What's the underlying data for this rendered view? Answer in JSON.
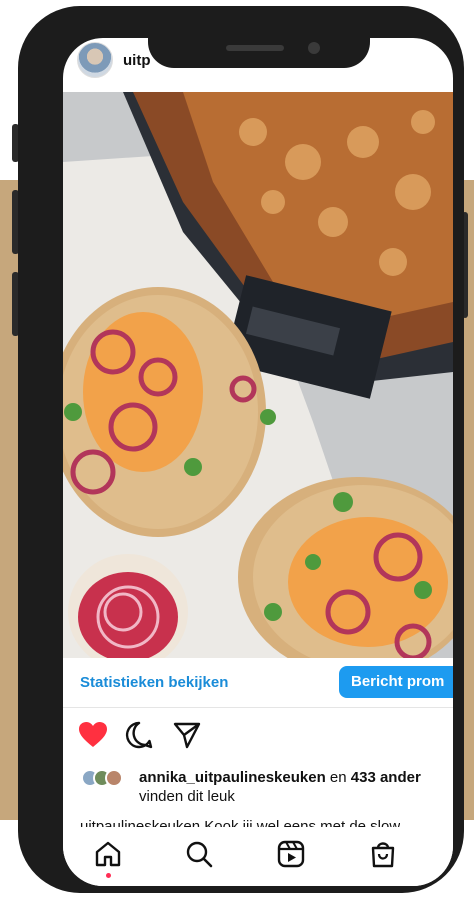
{
  "header": {
    "username": "uitp"
  },
  "post": {
    "image_description_icon": "photo-icon"
  },
  "promo": {
    "stats_label": "Statistieken bekijken",
    "promote_label": "Bericht prom"
  },
  "actions": {
    "like_icon": "heart-icon",
    "comment_icon": "comment-icon",
    "share_icon": "send-icon",
    "liked": true
  },
  "likes": {
    "liker": "annika_uitpaulineskeuken",
    "connector": " en ",
    "others": "433 ander",
    "line2": "vinden dit leuk"
  },
  "caption": {
    "text": "uitpaulineskeuken Kook jij wel eens met de slow"
  },
  "nav": {
    "items": [
      "home-icon",
      "search-icon",
      "reels-icon",
      "shop-icon"
    ],
    "active": "home-icon"
  },
  "colors": {
    "background_band": "#c6a77c",
    "accent_blue": "#1d9bf0",
    "like_red": "#ff3040"
  }
}
